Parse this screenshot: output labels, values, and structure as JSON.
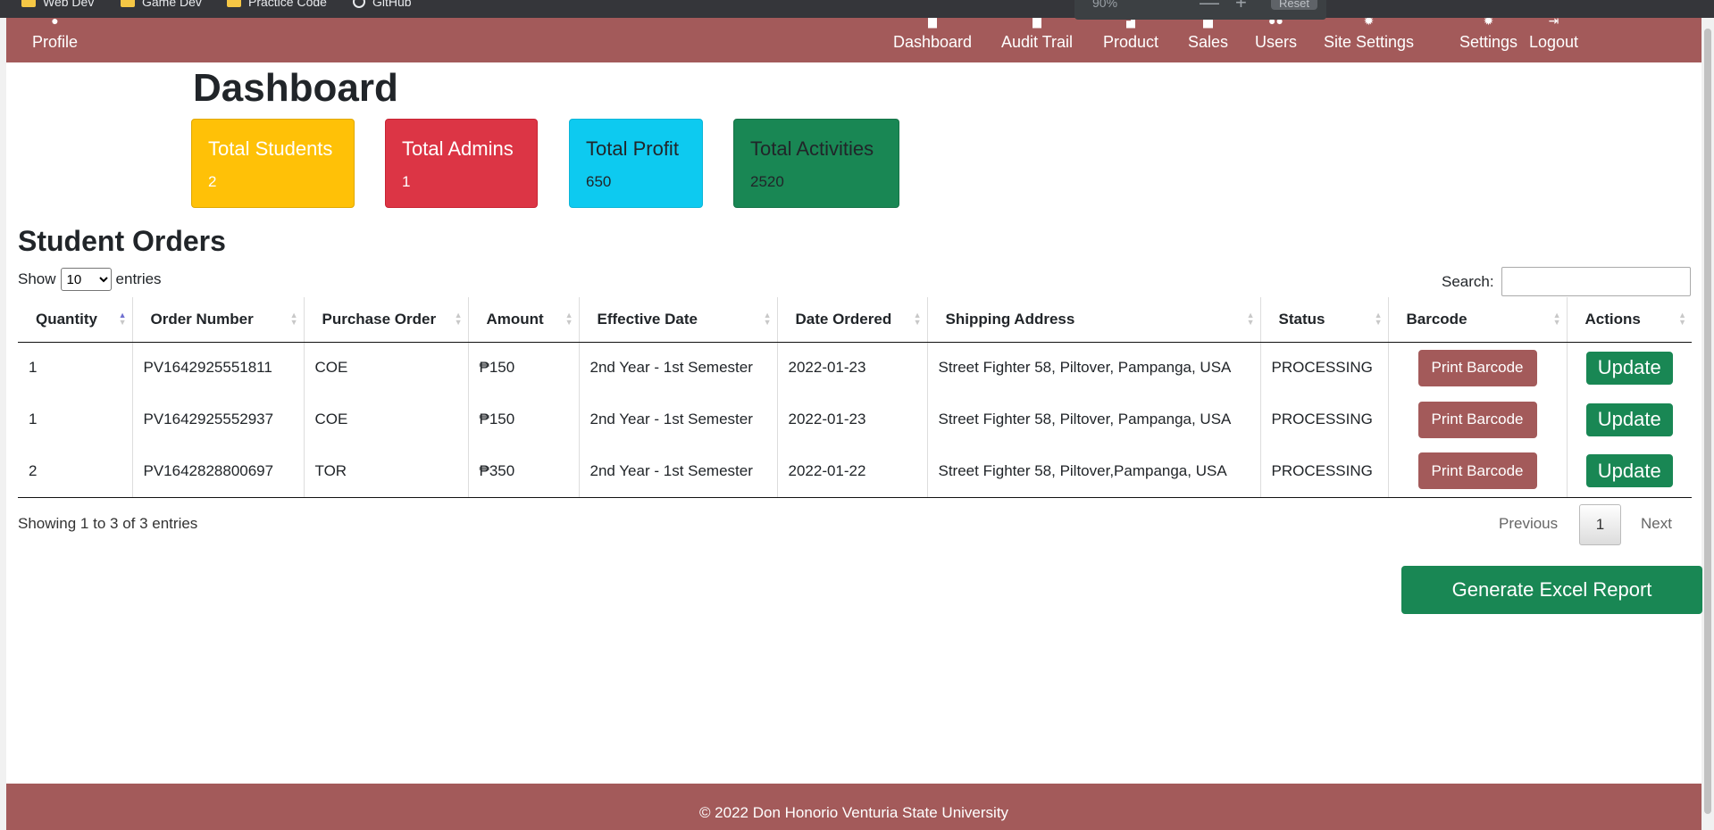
{
  "bookmarks": [
    {
      "label": "Web Dev",
      "icon": "folder-icon"
    },
    {
      "label": "Game Dev",
      "icon": "folder-icon"
    },
    {
      "label": "Practice Code",
      "icon": "folder-icon"
    },
    {
      "label": "GitHub",
      "icon": "github-icon"
    }
  ],
  "zoom": {
    "value": "90%",
    "minus": "—",
    "plus": "+",
    "reset": "Reset"
  },
  "nav": {
    "profile": "Profile",
    "dashboard": "Dashboard",
    "audit_trail": "Audit Trail",
    "product": "Product",
    "sales": "Sales",
    "users": "Users",
    "site_settings": "Site Settings",
    "settings": "Settings",
    "logout": "Logout"
  },
  "page_title": "Dashboard",
  "cards": {
    "students": {
      "title": "Total Students",
      "value": "2"
    },
    "admins": {
      "title": "Total Admins",
      "value": "1"
    },
    "profit": {
      "title": "Total Profit",
      "value": "650"
    },
    "activities": {
      "title": "Total Activities",
      "value": "2520"
    }
  },
  "orders": {
    "title": "Student Orders",
    "show_label": "Show",
    "entries_label": "entries",
    "page_size": "10",
    "search_label": "Search:",
    "search_value": "",
    "columns": {
      "quantity": "Quantity",
      "order_number": "Order Number",
      "purchase_order": "Purchase Order",
      "amount": "Amount",
      "effective_date": "Effective Date",
      "date_ordered": "Date Ordered",
      "shipping_address": "Shipping Address",
      "status": "Status",
      "barcode": "Barcode",
      "actions": "Actions"
    },
    "rows": [
      {
        "quantity": "1",
        "order_number": "PV1642925551811",
        "purchase_order": "COE",
        "amount": "₱150",
        "effective_date": "2nd Year - 1st Semester",
        "date_ordered": "2022-01-23",
        "shipping_address": "Street Fighter 58, Piltover, Pampanga, USA",
        "status": "PROCESSING",
        "barcode_btn": "Print Barcode",
        "action_btn": "Update"
      },
      {
        "quantity": "1",
        "order_number": "PV1642925552937",
        "purchase_order": "COE",
        "amount": "₱150",
        "effective_date": "2nd Year - 1st Semester",
        "date_ordered": "2022-01-23",
        "shipping_address": "Street Fighter 58, Piltover, Pampanga, USA",
        "status": "PROCESSING",
        "barcode_btn": "Print Barcode",
        "action_btn": "Update"
      },
      {
        "quantity": "2",
        "order_number": "PV1642828800697",
        "purchase_order": "TOR",
        "amount": "₱350",
        "effective_date": "2nd Year - 1st Semester",
        "date_ordered": "2022-01-22",
        "shipping_address": "Street Fighter 58, Piltover,Pampanga, USA",
        "status": "PROCESSING",
        "barcode_btn": "Print Barcode",
        "action_btn": "Update"
      }
    ],
    "info": "Showing 1 to 3 of 3 entries",
    "pagination": {
      "previous": "Previous",
      "current": "1",
      "next": "Next"
    }
  },
  "excel_button": "Generate Excel Report",
  "footer": "© 2022 Don Honorio Venturia State University",
  "colors": {
    "brand": "#a35a5a",
    "success": "#198754",
    "warning": "#ffc107",
    "danger": "#dc3545",
    "info": "#0dcaf0"
  }
}
